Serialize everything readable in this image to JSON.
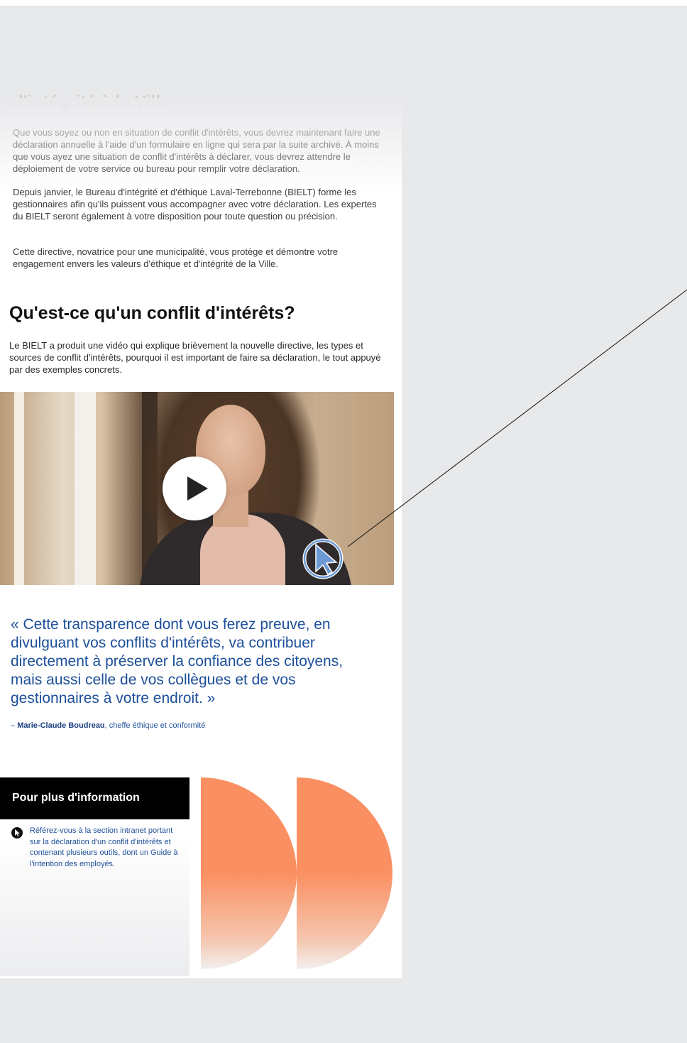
{
  "page": {
    "faded_heading": "d'intégrité à la Ville",
    "paragraphs": [
      "Que vous soyez ou non en situation de conflit d'intérêts, vous devrez maintenant faire une déclaration annuelle à l'aide d'un formulaire en ligne qui sera par la suite archivé. À moins que vous ayez une situation de conflit d'intérêts à déclarer, vous devrez attendre le déploiement de votre service ou bureau pour remplir votre déclaration.",
      "Depuis janvier, le Bureau d'intégrité et d'éthique Laval-Terrebonne (BIELT) forme les gestionnaires afin qu'ils puissent vous accompagner avec votre déclaration. Les expertes du BIELT seront également à votre disposition pour toute question ou précision.",
      "Cette directive, novatrice pour une municipalité, vous protège et démontre votre engagement envers les valeurs d'éthique et d'intégrité de la Ville."
    ],
    "section_heading": "Qu'est-ce qu'un conflit d'intérêts?",
    "intro": "Le BIELT a produit une vidéo qui explique brièvement la nouvelle directive, les types et sources de conflit d'intérêts, pourquoi il est important de faire sa déclaration, le tout appuyé par des exemples concrets.",
    "video": {
      "play_icon": "play-icon"
    },
    "quote": "« Cette transparence dont vous ferez preuve, en divulguant vos conflits d'intérêts, va contribuer directement à préserver la confiance des citoyens, mais aussi celle de vos collègues et de vos gestionnaires à votre endroit. »",
    "attribution": {
      "prefix": "– ",
      "name": "Marie-Claude Boudreau",
      "role": ", cheffe éthique et conformité"
    },
    "info_box": {
      "title": "Pour plus d'information",
      "link_icon": "cursor-icon",
      "link_text": "Référez-vous à la section intranet portant sur la déclaration d'un conflit d'intérêts et contenant plusieurs outils, dont un Guide à l'intention des employés."
    }
  },
  "colors": {
    "background": "#e8e9eb",
    "quote_blue": "#1d4f9a",
    "accent_orange": "#fa9062",
    "header_black": "#000000"
  },
  "annotation": {
    "icon": "cursor-click-icon"
  }
}
